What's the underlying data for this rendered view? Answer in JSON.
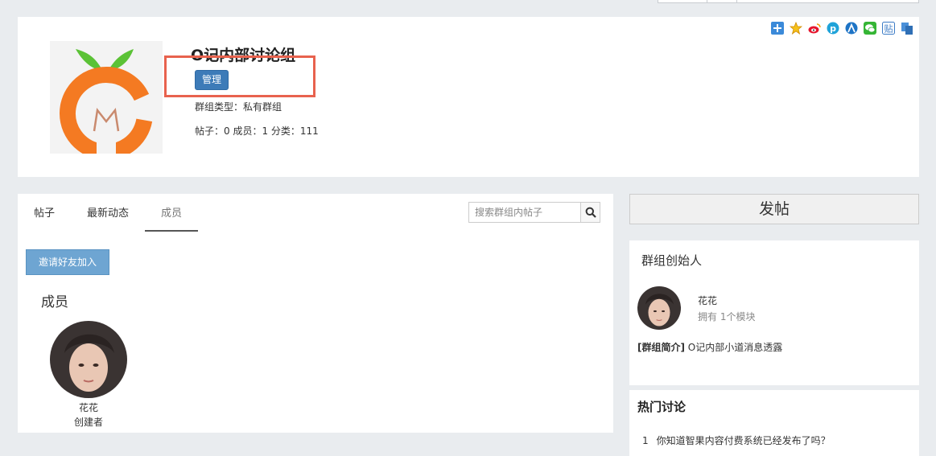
{
  "group": {
    "title": "O记内部讨论组",
    "manage_label": "管理",
    "type_line": "群组类型：私有群组",
    "stats_line": "帖子：0 成员：1 分类：111"
  },
  "share_icons": [
    "qzone-plus-icon",
    "favorite-star-icon",
    "weibo-icon",
    "pinterest-icon",
    "renren-icon",
    "wechat-icon",
    "tieba-icon",
    "copy-icon"
  ],
  "tabs": [
    {
      "label": "帖子",
      "active": false
    },
    {
      "label": "最新动态",
      "active": false
    },
    {
      "label": "成员",
      "active": true
    }
  ],
  "search": {
    "placeholder": "搜索群组内帖子"
  },
  "invite_label": "邀请好友加入",
  "members_heading": "成员",
  "members": [
    {
      "name": "花花",
      "role": "创建者"
    }
  ],
  "post_button_label": "发帖",
  "founder": {
    "heading": "群组创始人",
    "name": "花花",
    "subtitle": "拥有 1个模块",
    "intro_label": "[群组简介]",
    "intro_text": " O记内部小道消息透露"
  },
  "hot": {
    "heading": "热门讨论",
    "items": [
      {
        "num": "1",
        "text": "你知道智果内容付费系统已经发布了吗？"
      }
    ]
  },
  "colors": {
    "accent": "#3d7bb8",
    "invite": "#6ea5d2",
    "highlight": "#e8624e",
    "logo_orange": "#f47a22",
    "logo_green": "#5bc236"
  }
}
